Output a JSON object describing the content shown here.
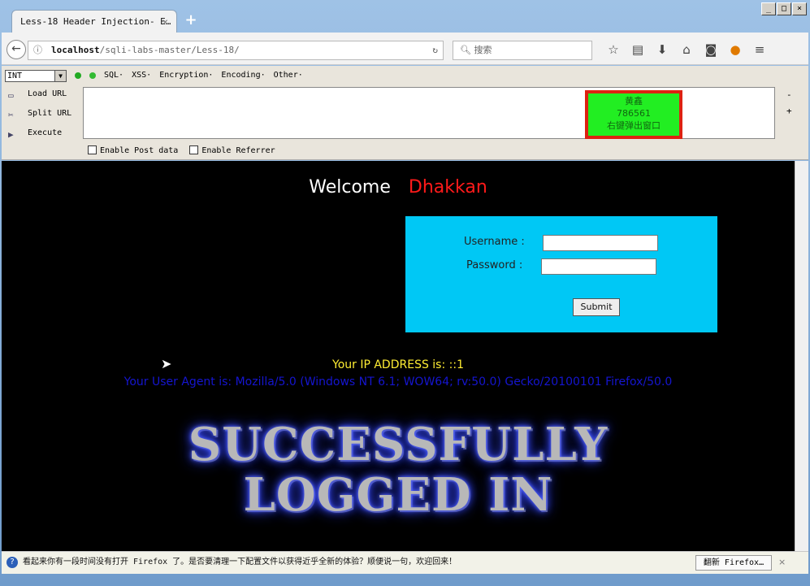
{
  "browser": {
    "tab_title": "Less-18 Header Injection- E…",
    "tab_close": "×",
    "new_tab": "+",
    "url_host": "localhost",
    "url_path": "/sqli-labs-master/Less-18/",
    "search_placeholder": "搜索",
    "icons": [
      "star-icon",
      "reading-list-icon",
      "download-icon",
      "home-icon",
      "pocket-icon",
      "extension-icon",
      "menu-icon"
    ]
  },
  "hackbar": {
    "select_value": "INT",
    "menus": [
      "SQL·",
      "XSS·",
      "Encryption·",
      "Encoding·",
      "Other·"
    ],
    "actions": {
      "load": "Load URL",
      "split": "Split URL",
      "execute": "Execute"
    },
    "popup": {
      "line1": "黄鑫",
      "line2": "786561",
      "line3": "右键弹出窗口"
    },
    "enable_post": "Enable Post data",
    "enable_referrer": "Enable Referrer",
    "minus": "-",
    "plus": "+"
  },
  "page": {
    "welcome": "Welcome",
    "name": "Dhakkan",
    "username_label": "Username :",
    "password_label": "Password :",
    "submit": "Submit",
    "ip": "Your IP ADDRESS is: ::1",
    "user_agent": "Your User Agent is: Mozilla/5.0 (Windows NT 6.1; WOW64; rv:50.0) Gecko/20100101 Firefox/50.0",
    "banner_line1": "SUCCESSFULLY",
    "banner_line2": "LOGGED IN"
  },
  "statusbar": {
    "message": "看起来你有一段时间没有打开 Firefox 了。是否要清理一下配置文件以获得近乎全新的体验？顺便说一句，欢迎回来！",
    "refresh_button": "翻新 Firefox…",
    "close": "×"
  }
}
